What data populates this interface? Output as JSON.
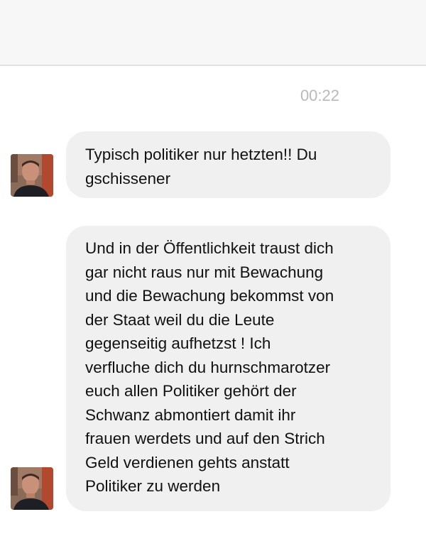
{
  "conversation": {
    "timestamp": "00:22"
  },
  "messages": [
    {
      "lines": [
        "Typisch politiker nur hetzten!! Du",
        "gschissener"
      ]
    },
    {
      "lines": [
        "Und in der Öffentlichkeit traust dich",
        "gar nicht raus nur mit Bewachung",
        "und die Bewachung bekommst von",
        "der Staat weil du die Leute",
        "gegenseitig aufhetzst ! Ich",
        "verfluche dich du hurnschmarotzer",
        "euch allen Politiker gehört der",
        "Schwanz abmontiert damit ihr",
        "frauen werdets und auf den Strich",
        "Geld verdienen gehts anstatt",
        "Politiker zu werden"
      ]
    }
  ]
}
